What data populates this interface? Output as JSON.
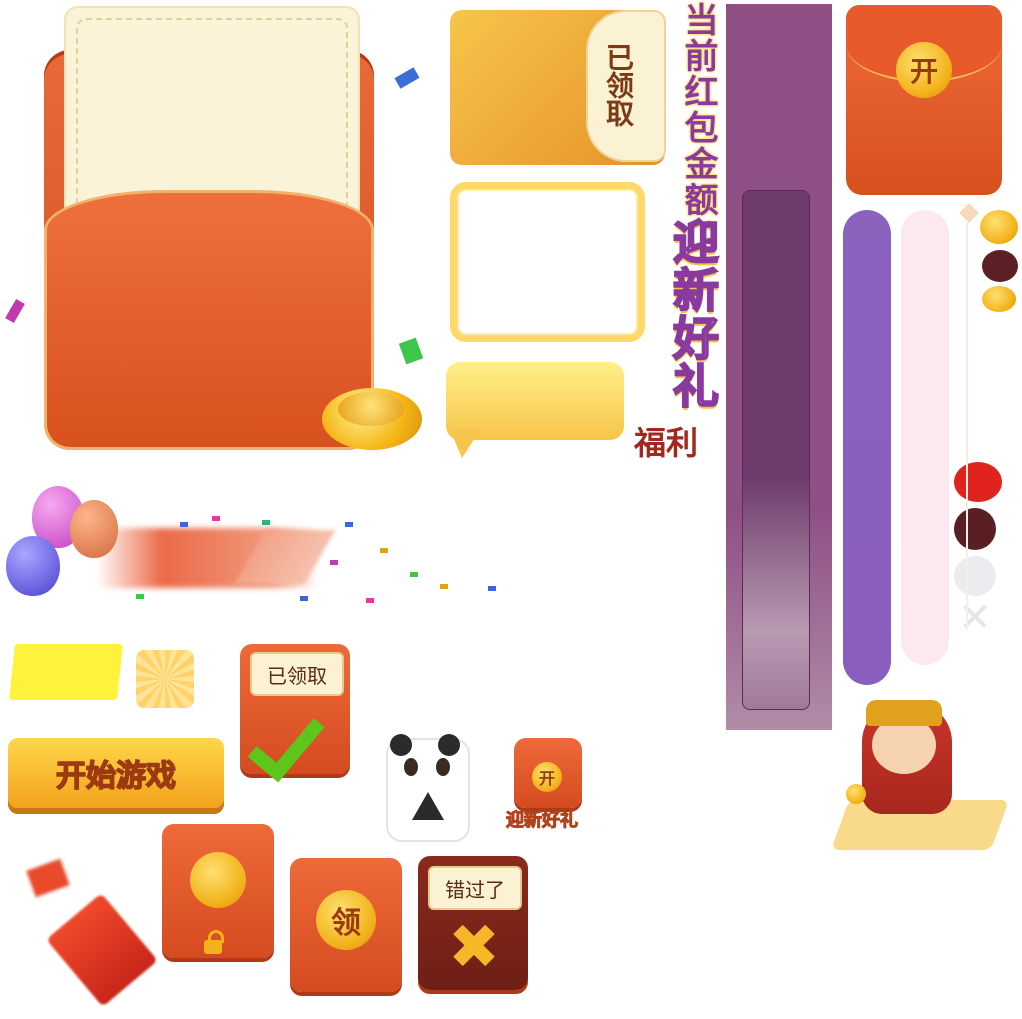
{
  "received_card": {
    "label": "已领取"
  },
  "side_labels": {
    "current_amount": "当前红包金额：",
    "newcomer_gift": "迎新好礼",
    "welfare": "福利"
  },
  "top_right_envelope": {
    "coin_label": "开"
  },
  "start_button": {
    "label": "开始游戏"
  },
  "received_small": {
    "label": "已领取"
  },
  "newcomer_small": {
    "coin_label": "开",
    "label": "迎新好礼"
  },
  "claim_envelope": {
    "coin_label": "领"
  },
  "missed_envelope": {
    "label": "错过了",
    "icon": "x"
  },
  "colors": {
    "envelope_red": "#e35a2b",
    "gold": "#f2b21a",
    "cream": "#fbf3d7",
    "purple_panel": "#8f5085",
    "violet_bar": "#8b63bf",
    "pink_bar": "#fbe8f0"
  },
  "icons": [
    "gold-ingot-icon",
    "checkmark-icon",
    "lock-icon",
    "close-x-icon",
    "balloon-icon",
    "panda-card-icon",
    "god-of-wealth-icon",
    "red-envelope-icon"
  ]
}
